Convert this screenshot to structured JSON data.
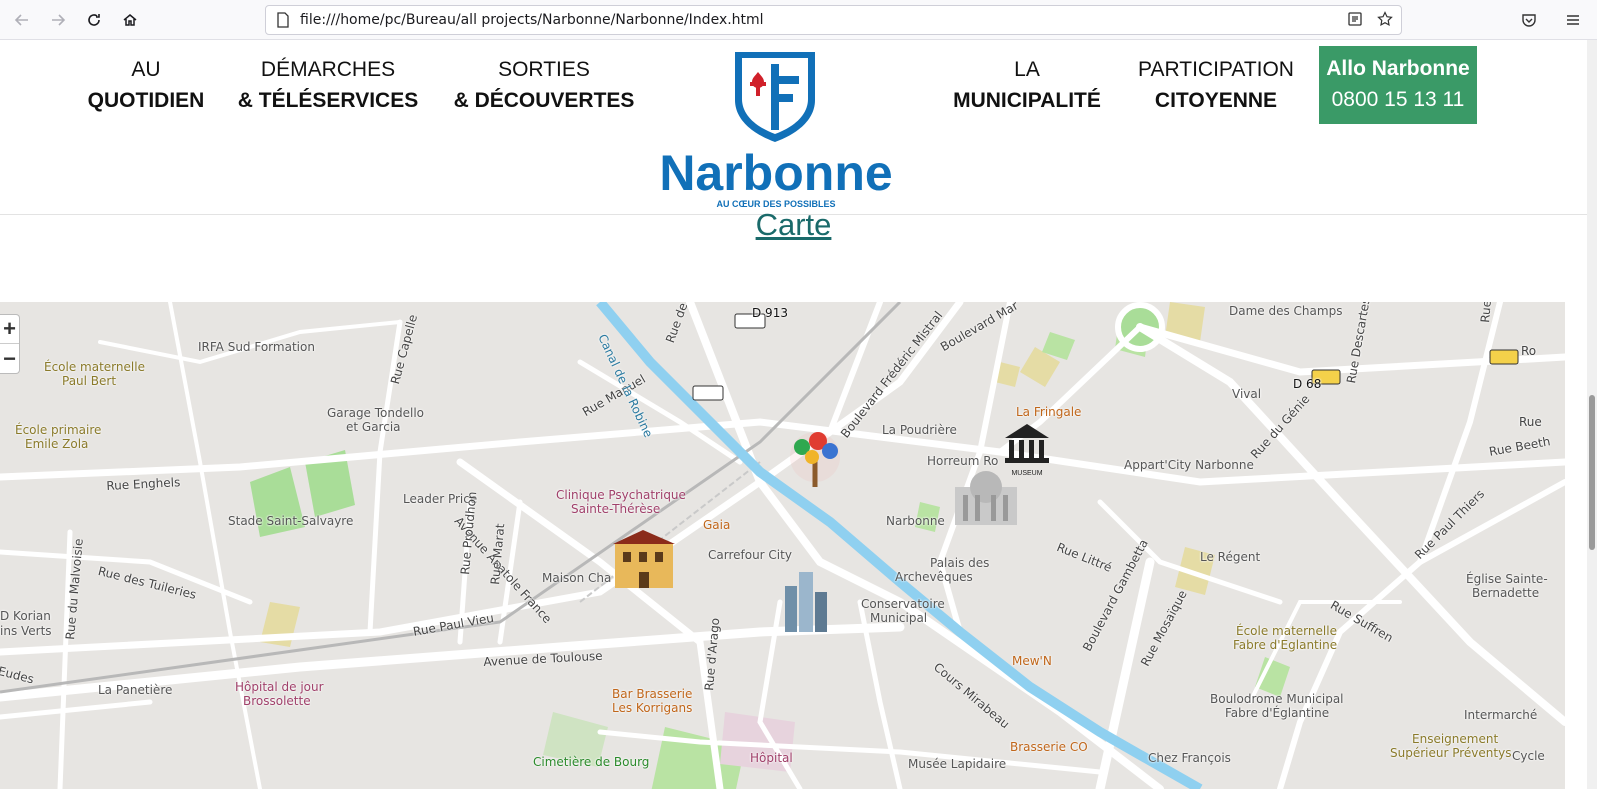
{
  "browser": {
    "url": "file:///home/pc/Bureau/all projects/Narbonne/Narbonne/Index.html"
  },
  "nav": {
    "items": [
      {
        "line1": "AU",
        "line2": "QUOTIDIEN"
      },
      {
        "line1": "DÉMARCHES",
        "line2": "& TÉLÉSERVICES"
      },
      {
        "line1": "SORTIES",
        "line2": "& DÉCOUVERTES"
      },
      {
        "line1": "LA",
        "line2": "MUNICIPALITÉ"
      },
      {
        "line1": "PARTICIPATION",
        "line2": "CITOYENNE"
      }
    ],
    "logo_text": "Narbonne",
    "logo_tagline": "AU CŒUR DES POSSIBLES",
    "allo_title": "Allo Narbonne",
    "allo_number": "0800 15 13 11"
  },
  "page": {
    "section_title": "Carte"
  },
  "map": {
    "zoom_in": "+",
    "zoom_out": "−",
    "labels": [
      "IRFA Sud Formation",
      "École maternelle",
      "Paul Bert",
      "Garage Tondello",
      "et Garcia",
      "École primaire",
      "Emile Zola",
      "Rue Enghels",
      "Leader Price",
      "Stade Saint-Salvayre",
      "Clinique Psychatrique",
      "Sainte-Thérèse",
      "Gaia",
      "Carrefour City",
      "Maison Cha",
      "Rue des Tuileries",
      "Rue Paul Vieu",
      "Avenue de Toulouse",
      "La Panetière",
      "Hôpital de jour",
      "Brossolette",
      "Bar Brasserie",
      "Les Korrigans",
      "Cimetière de Bourg",
      "Hôpital",
      "La Poudrière",
      "Horreum Ro",
      "La Fringale",
      "Narbonne",
      "Palais des",
      "Archevêques",
      "Conservatoire",
      "Municipal",
      "Mew'N",
      "Brasserie CO",
      "Musée Lapidaire",
      "Chez François",
      "Appart'City Narbonne",
      "Le Régent",
      "Vival",
      "Dame des Champs",
      "École maternelle",
      "Fabre d'Eglantine",
      "Boulodrome Municipal",
      "Fabre d'Églantine",
      "Enseignement",
      "Supérieur Préventys",
      "Intermarché",
      "Église Sainte-",
      "Bernadette",
      "Rue Suffren",
      "Rue Littré",
      "Boulevard Gambetta",
      "Cours Mirabeau",
      "Rue Mosaïque",
      "Avenue Anatole France",
      "Rue Manuel",
      "Rue Capelle",
      "Rue Proudhon",
      "Rue Marat",
      "Rue du Malvoisie",
      "Canal de la Robine",
      "Boulevard Frédéric Mistral",
      "Boulevard Mar",
      "Rue du Génie",
      "Rue Descartes",
      "Rue Paul Thiers",
      "Rue Beeth",
      "D Korian",
      "ins Verts",
      "Eudes",
      "Rue d'Arago",
      "D 913",
      "D 68",
      "Cycle",
      "Rue de la",
      "Rue P",
      "Ro",
      "Rue"
    ]
  }
}
